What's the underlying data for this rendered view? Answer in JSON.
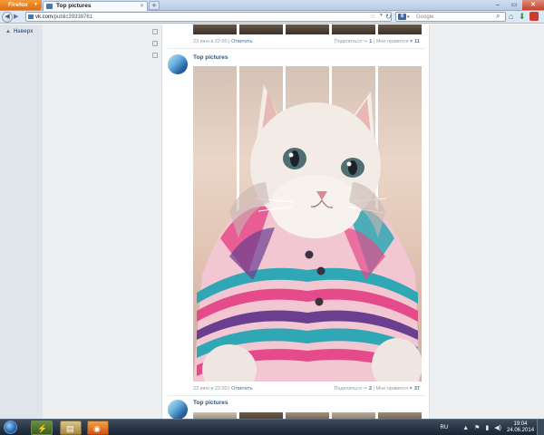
{
  "browser": {
    "app_button": "Firefox",
    "tab_title": "Top pictures",
    "url_host": "vk.com",
    "url_path": "/public39338761",
    "search_placeholder": "Google",
    "search_engine_letter": "8"
  },
  "sidebar": {
    "back_to_top": "Наверх"
  },
  "feed": {
    "top_meta": {
      "date": "23 июн в 22:00",
      "reply": "Ответить",
      "share": "Поделиться",
      "share_count": "1",
      "likes": "Мне нравится",
      "likes_count": "11"
    },
    "post": {
      "author": "Top pictures",
      "meta": {
        "date": "23 июн в 22:00",
        "reply": "Ответить",
        "share": "Поделиться",
        "share_count": "2",
        "likes": "Мне нравится",
        "likes_count": "37"
      }
    },
    "next_post": {
      "author": "Top pictures"
    }
  },
  "taskbar": {
    "lang": "RU",
    "time": "19:04",
    "date": "24.06.2014"
  }
}
